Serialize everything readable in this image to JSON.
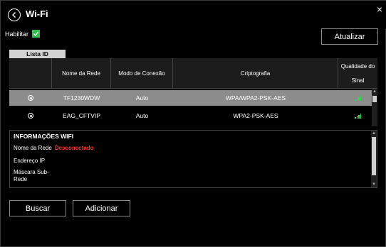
{
  "window": {
    "title": "Wi-Fi",
    "close_label": "×"
  },
  "toolbar": {
    "enable_label": "Habilitar",
    "enable_checked": true,
    "update_label": "Atualizar"
  },
  "tabs": [
    {
      "label": "Lista ID",
      "active": true
    }
  ],
  "table": {
    "headers": [
      "",
      "Nome da Rede",
      "Modo de Conexão",
      "Criptografia",
      "Qualidade do\nSinal"
    ],
    "rows": [
      {
        "network": "TF1230WDW",
        "mode": "Auto",
        "encryption": "WPA/WPA2-PSK-AES",
        "signal_bars": 4,
        "selected": true
      },
      {
        "network": "EAG_CFTVIP",
        "mode": "Auto",
        "encryption": "WPA2-PSK-AES",
        "signal_bars": 4,
        "selected": false
      }
    ]
  },
  "info": {
    "title": "INFORMAÇÕES WIFI",
    "network_label": "Nome da Rede",
    "status": "Desconectado",
    "ip_label": "Endereço IP",
    "mask_label": "Máscara Sub-\nRede"
  },
  "actions": {
    "search_label": "Buscar",
    "add_label": "Adicionar"
  },
  "colors": {
    "accent_green": "#2fbf4a",
    "signal_green": "#3ed34f",
    "status_red": "#ff3030",
    "selected_row": "#8c8c8c"
  },
  "icons": {
    "back": "back-circle-icon",
    "close": "close-icon",
    "check": "check-icon",
    "radio": "radio-icon",
    "signal": "signal-bars-icon"
  }
}
